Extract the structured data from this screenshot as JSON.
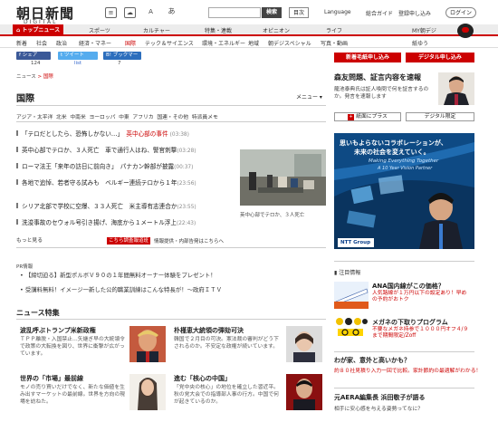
{
  "header": {
    "logo": "朝日新聞",
    "logo_sub": "DIGITAL",
    "icons": [
      "text-size-icon",
      "cloud-icon",
      "font-icon",
      "ah-icon"
    ],
    "search": {
      "placeholder": "",
      "button": "検索"
    },
    "toc": "目次",
    "language": "Language",
    "guide": "総合ガイド",
    "signup": "登録申し込み",
    "login": "ログイン"
  },
  "nav1": {
    "active": "トップニュース",
    "items": [
      "スポーツ",
      "カルチャー",
      "特集・連載",
      "オピニオン",
      "ライフ",
      "MY朝デジ"
    ],
    "extra": "MY朝デジ"
  },
  "nav2": {
    "items": [
      "新着",
      "社会",
      "政治",
      "経済・マネー",
      "国際",
      "テック＆サイエンス",
      "環境・エネルギー",
      "地域",
      "朝デジスペシャル",
      "写真・動画"
    ],
    "extra": "紙ゆう"
  },
  "social": {
    "share": "シェア",
    "share_count": "124",
    "tweet": "ツイート",
    "tweet_count": "list",
    "hatena": "ブックマーク",
    "hatena_count": "7"
  },
  "breadcrumb": {
    "home": "ニュース",
    "sep": ">",
    "current": "国際"
  },
  "section": {
    "title": "国際",
    "menu": "メニュー ▾"
  },
  "subnav": [
    "アジア・太平洋",
    "北米",
    "中南米",
    "ヨーロッパ",
    "中東",
    "アフリカ",
    "国連・その他",
    "特派員メモ"
  ],
  "news": [
    {
      "title": "「テロだとしたら、恐怖しかない…」",
      "tag": "英中心部の事件",
      "time": "(03:38)"
    },
    {
      "title": "英中心部でテロか、３人死亡　車で通行人はね、警官刺撃",
      "tag": "",
      "time": "(03:28)"
    },
    {
      "title": "ローマ法王「来年の訪日に前向き」　パナカン幹部が披露",
      "tag": "",
      "time": "(00:37)"
    },
    {
      "title": "各地で追悼、若者守る試みも　ベルギー連続テロから１年",
      "tag": "",
      "time": "(23:56)"
    },
    {
      "title": "シリア北部で学校に空爆、３３人死亡　米主導有志連合か",
      "tag": "",
      "time": "(23:55)"
    },
    {
      "title": "洗浚事故のセウォル号引き揚げ、海底から１メートル浮上",
      "tag": "",
      "time": "(22:43)"
    }
  ],
  "photo_caption": "英中心部でテロか、３人死亡",
  "more": "もっと見る",
  "pr_tag": "こちら調査報道班",
  "pr_tag_text": "情報提供・内部告発はこちらへ",
  "pr": {
    "label": "PR情報",
    "items": [
      "【締切迫る】新型ポルボＶ９０の１年間無料オーナー体験をプレゼント！",
      "受講料無料！イメージ一新した公的職業訓練はこんな特長が！～政府ＩＴＶ"
    ]
  },
  "features": {
    "title": "ニュース特集",
    "items": [
      {
        "title": "波乱呼ぶトランプ米新政権",
        "body": "ＴＰＰ離脱・入国禁止…矢継ぎ早の大統領令で政策の大転換を図り、世界に衝撃が広がっています。"
      },
      {
        "title": "朴槿恵大統領の弾劾可決",
        "body": "韓国で２月目の可決。憲法裁の審判がどう下されるのか。不安定な政権が続いています。"
      },
      {
        "title": "世界の「市場」最前線",
        "body": "モノの売り買いだけでなく、新たな価値を生み出すマーケットの最前線。世界を方向の現場を訪ねた。"
      },
      {
        "title": "進む「核心の中国」",
        "body": "「党中央の核心」の地位を確立した習近平。秋の党大会での指導部人事の行方。中国で何が起きているのか。"
      }
    ]
  },
  "right": {
    "btn_new": "新着毛紙申し込み",
    "btn_digital": "デジタル申し込み",
    "headline": "森友問題、証言内容を速報",
    "body": "籠池泰典氏は証人喚問で何を証言するのか。発言を速報します",
    "btn_plus": "紙面にプラス",
    "btn_limit": "デジタル限定",
    "ad": {
      "line1": "思いもよらないコラボレーションが、",
      "line2": "未来の社会を変えていく。",
      "line3": "Making Everything Together",
      "line4": "A 10 Year Vision Partner",
      "brand": "NTT Group"
    },
    "watch_label": "注目情報",
    "watch": [
      {
        "title": "ANA国内線がこの価格？",
        "body": "人気路線が１万円以下の設定あり！早めの予約がおトク"
      },
      {
        "title": "メガネの下取りプログラム",
        "body": "不要なメガネ持参で１０００円オフ４/９まで期間限定/Zoff"
      }
    ],
    "text_items": [
      {
        "title": "わが家、意外と高いかも？",
        "body": "約８０社見積り入力一回で比較。家計節約の最適解がわかる！"
      },
      {
        "title": "元AERA編集長 浜田敬子が語る",
        "body": "相手に安心感を与える姿勢ってなに？"
      }
    ]
  }
}
